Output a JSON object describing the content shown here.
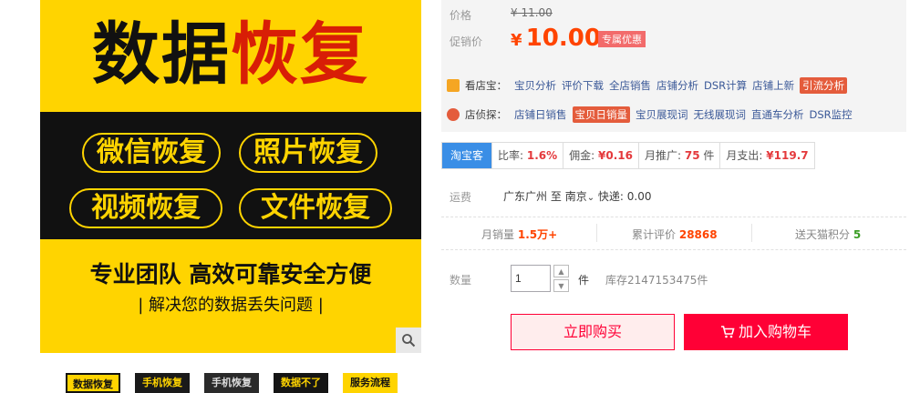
{
  "product_image": {
    "title_part1": "数据",
    "title_part2": "恢复",
    "pills": [
      "微信恢复",
      "照片恢复",
      "视频恢复",
      "文件恢复"
    ],
    "slogan": "专业团队 高效可靠安全方便",
    "subtitle": "| 解决您的数据丢失问题 |"
  },
  "thumbnails": [
    "数据恢复",
    "手机恢复",
    "手机恢复",
    "数据不了",
    "服务流程"
  ],
  "price": {
    "label": "价格",
    "original": "¥ 11.00",
    "promo_label": "促销价",
    "currency": "¥",
    "promo_value": "10.00",
    "promo_tag": "专属优惠"
  },
  "shop_tools": {
    "name": "看店宝：",
    "items": [
      "宝贝分析",
      "评价下载",
      "全店销售",
      "店铺分析",
      "DSR计算",
      "店铺上新",
      "引流分析"
    ]
  },
  "shop_detect": {
    "name": "店侦探：",
    "items": [
      "店铺日销售",
      "宝贝日销量",
      "宝贝展现词",
      "无线展现词",
      "直通车分析",
      "DSR监控"
    ]
  },
  "taobaoke": {
    "brand": "淘宝客",
    "rate_label": "比率:",
    "rate": "1.6%",
    "commission_label": "佣金:",
    "commission": "¥0.16",
    "monthly_promo_label": "月推广:",
    "monthly_promo": "75",
    "monthly_promo_unit": "件",
    "monthly_spend_label": "月支出:",
    "monthly_spend": "¥119.7"
  },
  "shipping": {
    "label": "运费",
    "from": "广东广州",
    "to_word": "至",
    "to": "南京",
    "method": "快递: 0.00"
  },
  "stats": {
    "sales_label": "月销量",
    "sales": "1.5万+",
    "reviews_label": "累计评价",
    "reviews": "28868",
    "points_label": "送天猫积分",
    "points": "5"
  },
  "quantity": {
    "label": "数量",
    "value": "1",
    "unit": "件",
    "stock": "库存2147153475件"
  },
  "buttons": {
    "buy_now": "立即购买",
    "add_to_cart": "加入购物车"
  },
  "colors": {
    "accent": "#ff0036",
    "price": "#ff4400",
    "image_yellow": "#ffd400",
    "title_red": "#d81e06"
  }
}
